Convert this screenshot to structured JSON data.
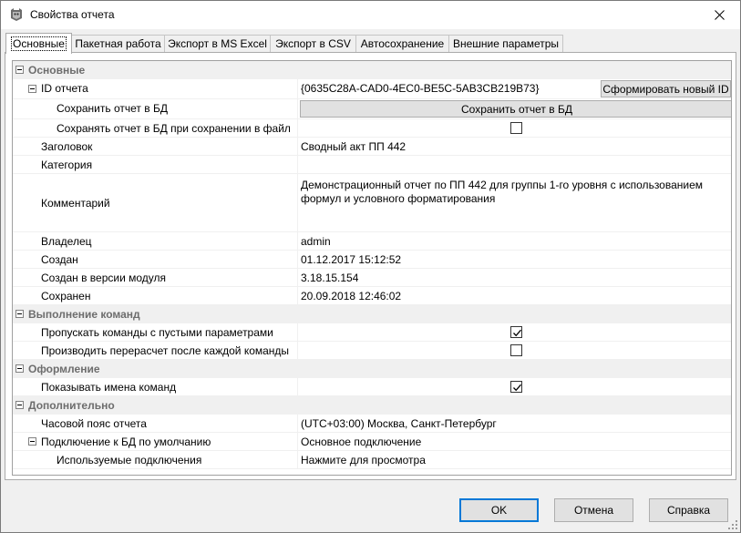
{
  "window": {
    "title": "Свойства отчета"
  },
  "tabs": [
    {
      "label": "Основные"
    },
    {
      "label": "Пакетная работа"
    },
    {
      "label": "Экспорт в MS Excel"
    },
    {
      "label": "Экспорт в CSV"
    },
    {
      "label": "Автосохранение"
    },
    {
      "label": "Внешние параметры"
    }
  ],
  "grid": {
    "cat_main": "Основные",
    "id": {
      "label": "ID отчета",
      "value": "{0635C28A-CAD0-4EC0-BE5C-5AB3CB219B73}",
      "button": "Сформировать новый ID"
    },
    "save_db": {
      "label": "Сохранить отчет в БД",
      "button": "Сохранить отчет в БД"
    },
    "save_db_on_file": {
      "label": "Сохранять отчет в БД при сохранении в файл",
      "checked": false
    },
    "header": {
      "label": "Заголовок",
      "value": "Сводный акт ПП 442"
    },
    "category": {
      "label": "Категория",
      "value": ""
    },
    "comment": {
      "label": "Комментарий",
      "value": "Демонстрационный отчет по ПП 442 для группы 1-го уровня с использованием формул и условного форматирования"
    },
    "owner": {
      "label": "Владелец",
      "value": "admin"
    },
    "created": {
      "label": "Создан",
      "value": "01.12.2017 15:12:52"
    },
    "created_ver": {
      "label": "Создан в версии модуля",
      "value": "3.18.15.154"
    },
    "saved": {
      "label": "Сохранен",
      "value": "20.09.2018 12:46:02"
    },
    "cat_exec": "Выполнение команд",
    "skip_empty": {
      "label": "Пропускать команды с пустыми параметрами",
      "checked": true
    },
    "recalc": {
      "label": "Производить перерасчет после каждой команды",
      "checked": false
    },
    "cat_design": "Оформление",
    "show_names": {
      "label": "Показывать имена команд",
      "checked": true
    },
    "cat_extra": "Дополнительно",
    "timezone": {
      "label": "Часовой пояс отчета",
      "value": "(UTC+03:00) Москва, Санкт-Петербург"
    },
    "db_conn": {
      "label": "Подключение к БД по умолчанию",
      "value": "Основное подключение"
    },
    "used_conn": {
      "label": "Используемые подключения",
      "value": "Нажмите для просмотра"
    }
  },
  "buttons": {
    "ok": "OK",
    "cancel": "Отмена",
    "help": "Справка"
  },
  "colors": {
    "category_bg": "#f0f0f0",
    "category_text": "#6d6d6d",
    "default_button_border": "#0078d7"
  }
}
